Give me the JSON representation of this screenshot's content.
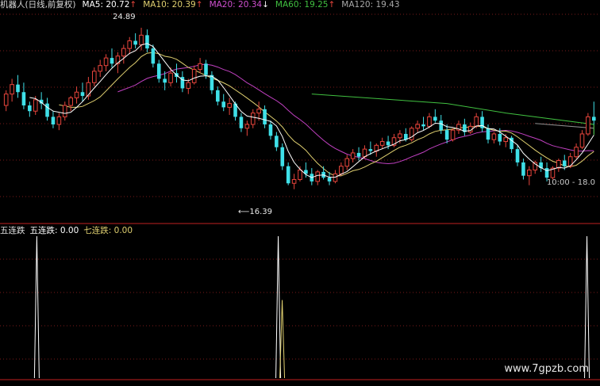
{
  "header": {
    "name": "机器人(日线,前复权)",
    "ma5": "MA5: 20.72",
    "ma10": "MA10: 20.39",
    "ma20": "MA20: 20.34",
    "ma60": "MA60: 19.25",
    "ma120": "MA120: 19.43",
    "arrow_up": "↑",
    "arrow_down": "↓"
  },
  "colors": {
    "up": "#e8453c",
    "down": "#3fe0e8",
    "ma5": "#ffffff",
    "ma10": "#e0d070",
    "ma20": "#c040c0",
    "ma60": "#40c040",
    "ma120": "#909090",
    "grid": "#7a1a1a",
    "divider": "#c02020"
  },
  "annotations": {
    "high_label": "24.89",
    "low_label": "16.39",
    "right_label": "10:00 - 18.0"
  },
  "indicator": {
    "title": "五连跌",
    "item1": "五连跌: 0.00",
    "item2": "七连跌: 0.00"
  },
  "watermark": "www.7gpzb.com",
  "chart_data": {
    "type": "candlestick",
    "price_range": [
      15.0,
      25.6
    ],
    "high": 24.89,
    "low": 16.39,
    "candles": [
      [
        20.8,
        21.6,
        20.5,
        21.4
      ],
      [
        21.4,
        22.2,
        21.0,
        21.9
      ],
      [
        21.9,
        22.4,
        21.2,
        21.5
      ],
      [
        21.5,
        22.0,
        20.6,
        20.8
      ],
      [
        20.8,
        21.0,
        20.2,
        20.5
      ],
      [
        20.5,
        21.3,
        20.3,
        21.1
      ],
      [
        21.1,
        21.5,
        20.6,
        20.9
      ],
      [
        20.9,
        21.2,
        20.0,
        20.2
      ],
      [
        20.2,
        20.5,
        19.6,
        19.8
      ],
      [
        19.8,
        20.4,
        19.5,
        20.2
      ],
      [
        20.2,
        21.0,
        20.0,
        20.8
      ],
      [
        20.8,
        21.3,
        20.5,
        21.2
      ],
      [
        21.2,
        21.8,
        20.9,
        21.5
      ],
      [
        21.5,
        22.0,
        21.0,
        21.3
      ],
      [
        21.3,
        22.3,
        21.1,
        22.0
      ],
      [
        22.0,
        22.8,
        21.8,
        22.6
      ],
      [
        22.6,
        23.2,
        22.3,
        22.9
      ],
      [
        22.9,
        23.5,
        22.6,
        23.3
      ],
      [
        23.3,
        23.8,
        22.8,
        23.0
      ],
      [
        23.0,
        23.6,
        22.5,
        23.4
      ],
      [
        23.4,
        24.0,
        23.0,
        23.8
      ],
      [
        23.8,
        24.4,
        23.5,
        24.2
      ],
      [
        24.2,
        24.6,
        23.8,
        24.0
      ],
      [
        24.0,
        24.89,
        23.7,
        24.5
      ],
      [
        24.5,
        24.8,
        23.6,
        23.8
      ],
      [
        23.8,
        24.0,
        22.8,
        23.0
      ],
      [
        23.0,
        23.2,
        22.0,
        22.2
      ],
      [
        22.2,
        22.6,
        21.6,
        22.0
      ],
      [
        22.0,
        22.8,
        21.8,
        22.5
      ],
      [
        22.5,
        23.0,
        22.0,
        22.3
      ],
      [
        22.3,
        22.6,
        21.5,
        21.7
      ],
      [
        21.7,
        22.2,
        21.4,
        22.0
      ],
      [
        22.0,
        22.9,
        21.9,
        22.7
      ],
      [
        22.7,
        23.3,
        22.5,
        23.0
      ],
      [
        23.0,
        23.2,
        22.2,
        22.4
      ],
      [
        22.4,
        22.6,
        21.4,
        21.6
      ],
      [
        21.6,
        21.8,
        20.8,
        21.0
      ],
      [
        21.0,
        21.4,
        20.5,
        20.7
      ],
      [
        20.7,
        21.2,
        20.3,
        20.9
      ],
      [
        20.9,
        21.0,
        20.0,
        20.2
      ],
      [
        20.2,
        20.4,
        19.4,
        19.6
      ],
      [
        19.6,
        20.0,
        19.2,
        19.8
      ],
      [
        19.8,
        20.6,
        19.6,
        20.4
      ],
      [
        20.4,
        21.0,
        20.0,
        20.6
      ],
      [
        20.6,
        20.8,
        19.6,
        19.8
      ],
      [
        19.8,
        20.0,
        19.0,
        19.2
      ],
      [
        19.2,
        19.4,
        18.4,
        18.6
      ],
      [
        18.6,
        18.8,
        17.4,
        17.6
      ],
      [
        17.6,
        17.8,
        16.6,
        16.7
      ],
      [
        16.7,
        17.2,
        16.39,
        16.9
      ],
      [
        16.9,
        17.6,
        16.8,
        17.4
      ],
      [
        17.4,
        17.8,
        17.0,
        17.2
      ],
      [
        17.2,
        17.5,
        16.6,
        16.8
      ],
      [
        16.8,
        17.4,
        16.6,
        17.3
      ],
      [
        17.3,
        17.6,
        16.9,
        17.0
      ],
      [
        17.0,
        17.3,
        16.6,
        16.8
      ],
      [
        16.8,
        17.4,
        16.7,
        17.2
      ],
      [
        17.2,
        17.8,
        17.1,
        17.6
      ],
      [
        17.6,
        18.2,
        17.4,
        18.0
      ],
      [
        18.0,
        18.5,
        17.8,
        18.3
      ],
      [
        18.3,
        18.6,
        17.9,
        18.1
      ],
      [
        18.1,
        18.7,
        18.0,
        18.5
      ],
      [
        18.5,
        18.9,
        18.2,
        18.4
      ],
      [
        18.4,
        18.8,
        18.1,
        18.7
      ],
      [
        18.7,
        19.1,
        18.5,
        18.9
      ],
      [
        18.9,
        19.2,
        18.5,
        18.7
      ],
      [
        18.7,
        19.3,
        18.6,
        19.1
      ],
      [
        19.1,
        19.5,
        18.8,
        19.3
      ],
      [
        19.3,
        19.6,
        18.9,
        19.0
      ],
      [
        19.0,
        19.7,
        18.9,
        19.6
      ],
      [
        19.6,
        20.0,
        19.4,
        19.8
      ],
      [
        19.8,
        20.2,
        19.5,
        19.7
      ],
      [
        19.7,
        20.4,
        19.6,
        20.2
      ],
      [
        20.2,
        20.6,
        19.9,
        20.0
      ],
      [
        20.0,
        20.3,
        19.3,
        19.5
      ],
      [
        19.5,
        19.8,
        18.8,
        19.0
      ],
      [
        19.0,
        19.6,
        18.9,
        19.5
      ],
      [
        19.5,
        20.0,
        19.3,
        19.8
      ],
      [
        19.8,
        20.1,
        19.2,
        19.4
      ],
      [
        19.4,
        19.9,
        19.3,
        19.7
      ],
      [
        19.7,
        20.4,
        19.6,
        20.2
      ],
      [
        20.2,
        20.5,
        19.4,
        19.6
      ],
      [
        19.6,
        19.8,
        18.8,
        19.0
      ],
      [
        19.0,
        19.4,
        18.8,
        19.3
      ],
      [
        19.3,
        19.6,
        18.7,
        18.9
      ],
      [
        18.9,
        19.3,
        18.6,
        19.1
      ],
      [
        19.1,
        19.2,
        18.3,
        18.5
      ],
      [
        18.5,
        18.7,
        17.6,
        17.8
      ],
      [
        17.8,
        18.0,
        16.9,
        17.1
      ],
      [
        17.1,
        17.6,
        16.6,
        17.4
      ],
      [
        17.4,
        17.9,
        17.2,
        17.8
      ],
      [
        17.8,
        18.1,
        17.3,
        17.5
      ],
      [
        17.5,
        17.8,
        16.8,
        17.0
      ],
      [
        17.0,
        17.6,
        16.9,
        17.5
      ],
      [
        17.5,
        18.0,
        17.3,
        17.9
      ],
      [
        17.9,
        18.2,
        17.4,
        17.6
      ],
      [
        17.6,
        18.3,
        17.5,
        18.1
      ],
      [
        18.1,
        18.8,
        18.0,
        18.6
      ],
      [
        18.6,
        19.5,
        18.5,
        19.3
      ],
      [
        19.3,
        20.4,
        19.2,
        20.2
      ],
      [
        20.2,
        21.0,
        19.8,
        20.0
      ]
    ],
    "ma120_line": [
      [
        90,
        19.85
      ],
      [
        128,
        19.6
      ],
      [
        178,
        19.8
      ],
      [
        205,
        19.6
      ],
      [
        255,
        19.3
      ]
    ],
    "ma60_line": [
      [
        52,
        21.4
      ],
      [
        75,
        20.9
      ],
      [
        85,
        20.4
      ],
      [
        105,
        19.8
      ],
      [
        128,
        19.4
      ],
      [
        170,
        19.3
      ],
      [
        210,
        19.25
      ]
    ],
    "signals": [
      {
        "index": 8,
        "value": 1
      },
      {
        "index": 69,
        "value": 1
      },
      {
        "index": 70,
        "value": 0.55
      },
      {
        "index": 147,
        "value": 1
      }
    ]
  }
}
